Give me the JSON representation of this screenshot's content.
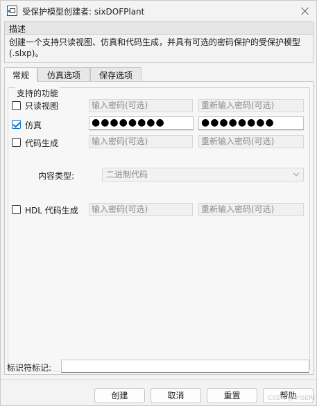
{
  "window": {
    "title": "受保护模型创建者: sixDOFPlant",
    "title_icon": "simulink-model-icon",
    "close_icon": "close-icon"
  },
  "description": {
    "header": "描述",
    "text": "创建一个支持只读视图、仿真和代码生成，并具有可选的密码保护的受保护模型(.slxp)。"
  },
  "tabs": [
    {
      "label": "常规",
      "active": true
    },
    {
      "label": "仿真选项",
      "active": false
    },
    {
      "label": "保存选项",
      "active": false
    }
  ],
  "group": {
    "title": "支持的功能",
    "rows": [
      {
        "label": "只读视图",
        "checked": false,
        "password": {
          "placeholder": "输入密码(可选)",
          "value": ""
        },
        "confirm": {
          "placeholder": "重新输入密码(可选)",
          "value": ""
        }
      },
      {
        "label": "仿真",
        "checked": true,
        "password": {
          "placeholder": "",
          "value": "●●●●●●●●"
        },
        "confirm": {
          "placeholder": "",
          "value": "●●●●●●●●"
        }
      },
      {
        "label": "代码生成",
        "checked": false,
        "password": {
          "placeholder": "输入密码(可选)",
          "value": ""
        },
        "confirm": {
          "placeholder": "重新输入密码(可选)",
          "value": ""
        }
      }
    ],
    "content_type": {
      "label": "内容类型:",
      "value": "二进制代码"
    },
    "hdl": {
      "label": "HDL 代码生成",
      "checked": false,
      "password": {
        "placeholder": "输入密码(可选)",
        "value": ""
      },
      "confirm": {
        "placeholder": "重新输入密码(可选)",
        "value": ""
      }
    }
  },
  "identifier": {
    "label": "标识符标记:",
    "value": ""
  },
  "buttons": {
    "create": "创建",
    "cancel": "取消",
    "reset": "重置",
    "help": "帮助"
  },
  "watermark": "CSDN @#ISERI",
  "colors": {
    "accent": "#0b6fc7",
    "background": "#f3f3f3"
  }
}
